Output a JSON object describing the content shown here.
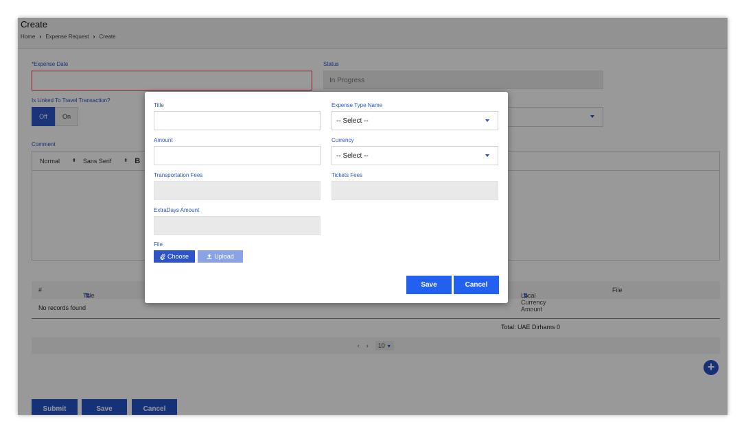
{
  "page": {
    "title": "Create",
    "breadcrumb": [
      "Home",
      "Expense Request",
      "Create"
    ]
  },
  "form": {
    "expense_date_label": "*Expense Date",
    "status_label": "Status",
    "status_value": "In Progress",
    "linked_label": "Is Linked To Travel Transaction?",
    "toggle_off": "Off",
    "toggle_on": "On",
    "comment_label": "Comment",
    "editor_toolbar": [
      "Normal",
      "Sans Serif",
      "B"
    ]
  },
  "table": {
    "columns": [
      "#",
      "Title",
      "Local Currency Amount",
      "File"
    ],
    "sort_glyph": "⇅",
    "empty_text": "No records found",
    "total_label": "Total:",
    "total_value": "UAE Dirhams 0",
    "pager": {
      "prev": "‹",
      "next": "›",
      "page_size": "10"
    }
  },
  "footer": {
    "submit": "Submit",
    "save": "Save",
    "cancel": "Cancel"
  },
  "modal": {
    "title_label": "Title",
    "expense_type_label": "Expense Type Name",
    "expense_type_value": "-- Select --",
    "amount_label": "Amount",
    "currency_label": "Currency",
    "currency_value": "-- Select --",
    "transport_label": "Transportation Fees",
    "tickets_label": "Tickets Fees",
    "extradays_label": "ExtraDays Amount",
    "file_label": "File",
    "choose_label": "Choose",
    "upload_label": "Upload",
    "save_label": "Save",
    "cancel_label": "Cancel"
  },
  "colors": {
    "accent": "#2453c8",
    "primary_button": "#2260ef",
    "error_border": "#d9303e",
    "overlay": "rgba(0,0,0,0.4)"
  }
}
